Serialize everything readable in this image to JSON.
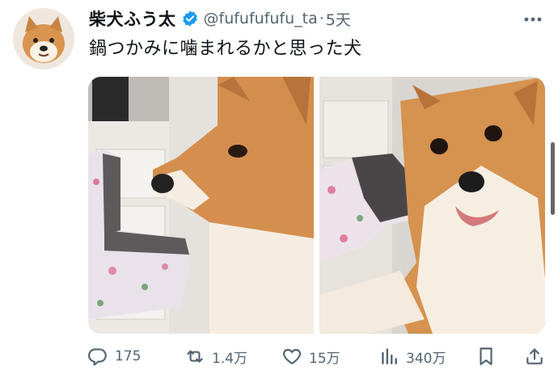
{
  "tweet": {
    "author_name": "柴犬ふう太",
    "handle": "@fufufufufu_ta",
    "separator": "·",
    "time": "5天",
    "text": "鍋つかみに噛まれるかと思った犬",
    "verified": true
  },
  "stats": {
    "replies": "175",
    "retweets": "1.4万",
    "likes": "15万",
    "views": "340万"
  },
  "colors": {
    "text": "#0f1419",
    "secondary": "#536471",
    "verified_badge": "#1d9bf0"
  },
  "icons": {
    "more": "more-horizontal-icon",
    "reply": "reply-icon",
    "retweet": "retweet-icon",
    "like": "heart-icon",
    "views": "views-chart-icon",
    "bookmark": "bookmark-icon",
    "share": "share-icon"
  }
}
